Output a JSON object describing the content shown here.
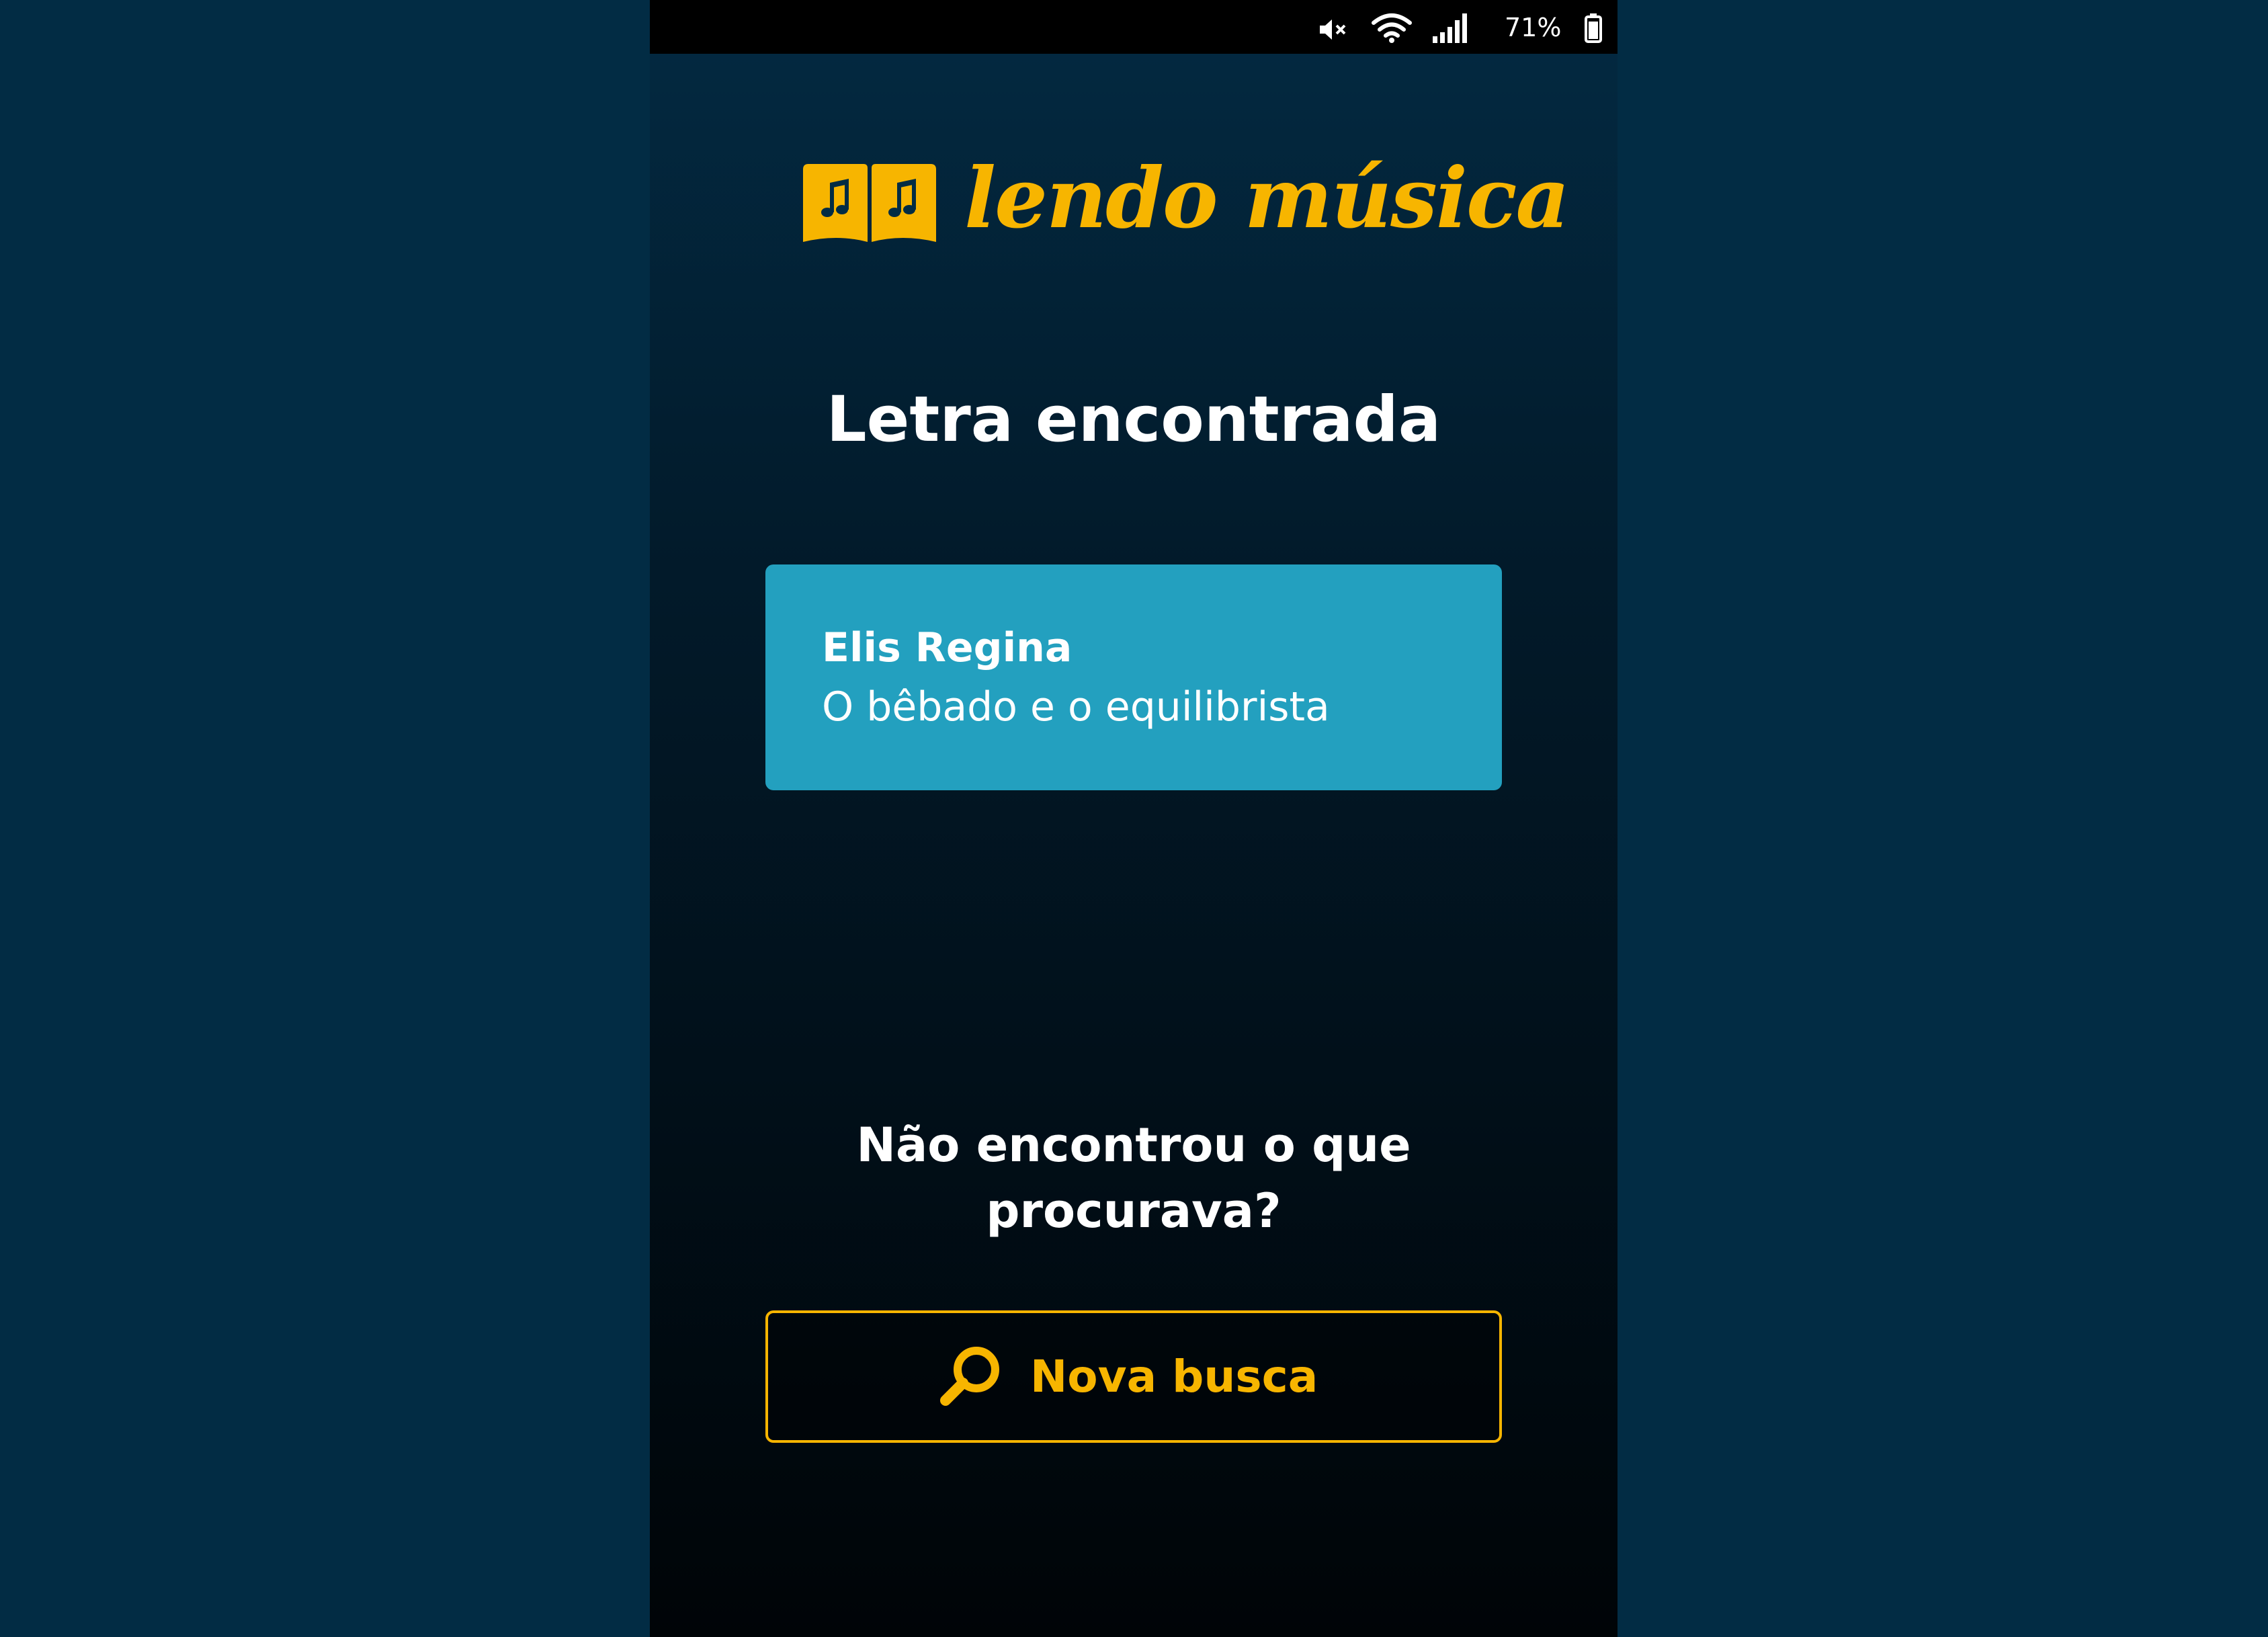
{
  "status_bar": {
    "battery_percent": "71%",
    "icons": [
      "mute-icon",
      "wifi-icon",
      "signal-icon",
      "battery-icon"
    ]
  },
  "logo": {
    "text": "lendo música",
    "icon": "open-book-music-notes-icon"
  },
  "title": "Letra encontrada",
  "results": [
    {
      "artist": "Elis Regina",
      "song": "O bêbado e o equilibrista"
    }
  ],
  "prompt": {
    "line1": "Não encontrou o que",
    "line2": "procurava?"
  },
  "new_search_button": {
    "label": "Nova busca",
    "icon": "search-icon"
  },
  "colors": {
    "background": "#022c44",
    "accent": "#f7b500",
    "card": "#23a0bf",
    "text": "#ffffff"
  }
}
